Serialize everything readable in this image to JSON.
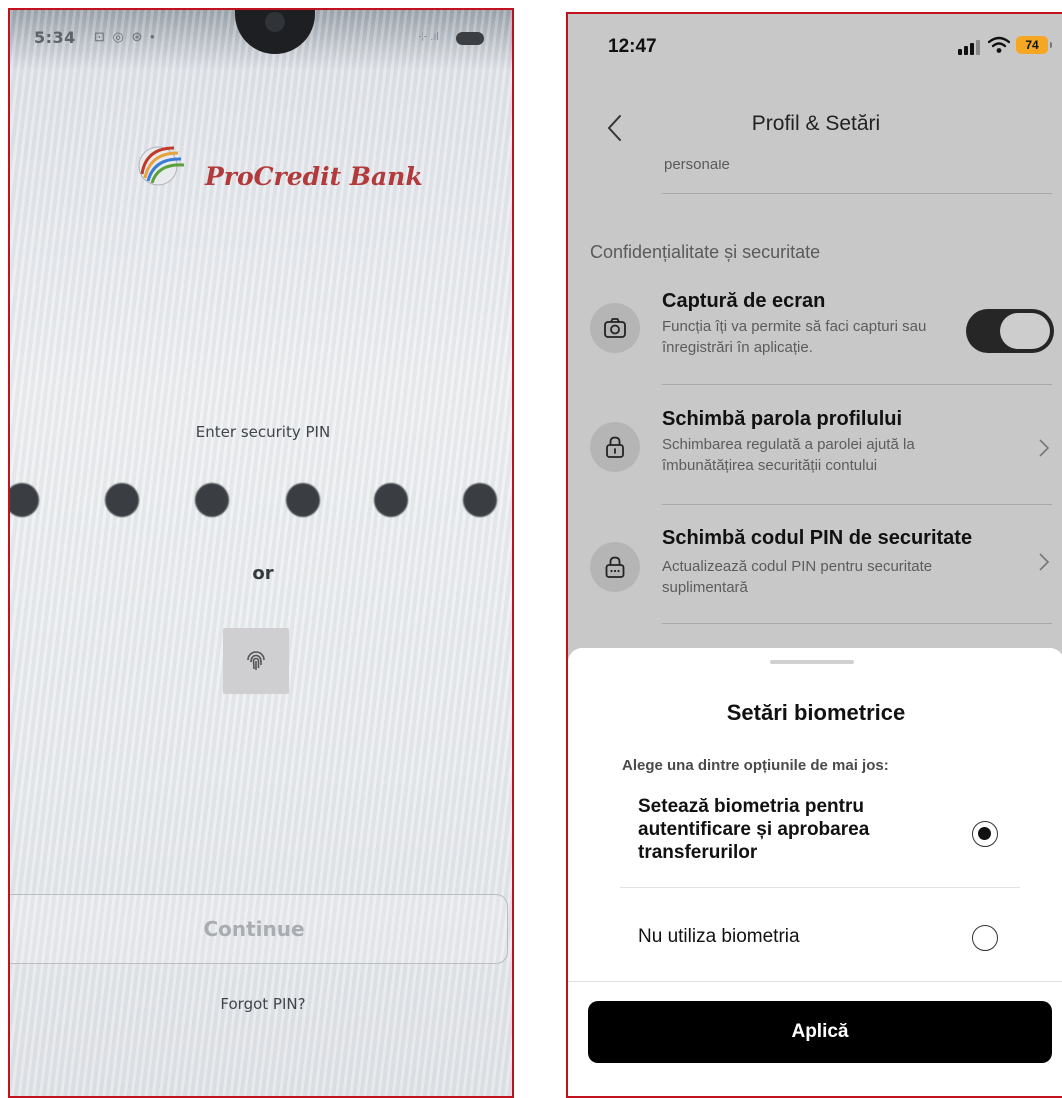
{
  "left_screen": {
    "status_time": "5:34",
    "status_icons": "⊡ ◎ ⊛ •",
    "status_signal": "⊹ .ıl",
    "brand_name": "ProCredit Bank",
    "enter_pin_label": "Enter security PIN",
    "pin_length": 6,
    "or_label": "or",
    "continue_label": "Continue",
    "forgot_pin_label": "Forgot PIN?"
  },
  "right_screen": {
    "status_time": "12:47",
    "battery_level": "74",
    "nav_title": "Profil & Setări",
    "partial_item_text": "personale",
    "section_title": "Confidențialitate și securitate",
    "items": [
      {
        "title": "Captură de ecran",
        "description": "Funcția îți va permite să faci capturi sau înregistrări în aplicație.",
        "toggle_on": true
      },
      {
        "title": "Schimbă parola profilului",
        "description": "Schimbarea regulată a parolei ajută la îmbunătățirea securității contului"
      },
      {
        "title": "Schimbă codul PIN de securitate",
        "description": "Actualizează codul PIN pentru securitate suplimentară"
      }
    ],
    "sheet": {
      "title": "Setări biometrice",
      "subtitle": "Alege una dintre opțiunile de mai jos:",
      "options": [
        {
          "label": "Setează biometria pentru autentificare și aprobarea transferurilor",
          "selected": true
        },
        {
          "label": "Nu utiliza biometria",
          "selected": false
        }
      ],
      "apply_label": "Aplică"
    }
  },
  "colors": {
    "brand_red": "#b23a3a",
    "frame_red": "#c1121f",
    "ios_battery": "#f5a623"
  }
}
